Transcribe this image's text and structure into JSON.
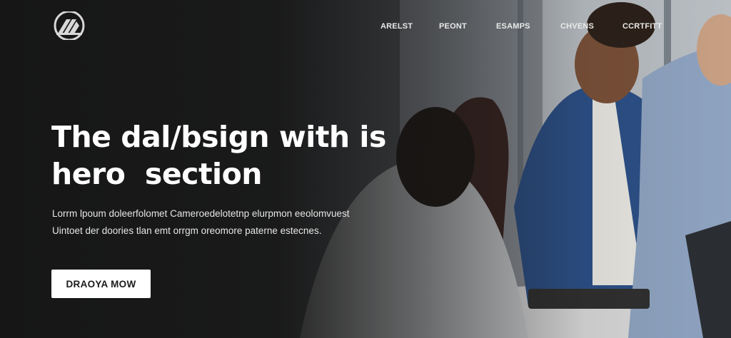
{
  "nav": {
    "items": [
      {
        "label": "ARELST"
      },
      {
        "label": "PEONT"
      },
      {
        "label": "ESAMPS"
      },
      {
        "label": "CHVENS"
      },
      {
        "label": "CCRTFITT"
      }
    ]
  },
  "hero": {
    "title_line1": "The dal/bsign with is",
    "title_line2": "hero  section",
    "description": "Lorrm lpoum doleerfolomet Cameroedelotetnp elurpmon eeolomvuest Uintoet der doories tlan emt orrgm oreomore paterne estecnes.",
    "cta_label": "DRAOYA MOW"
  },
  "colors": {
    "overlay": "#141414",
    "text": "#ffffff",
    "button_bg": "#ffffff",
    "button_text": "#1b1b1b"
  }
}
